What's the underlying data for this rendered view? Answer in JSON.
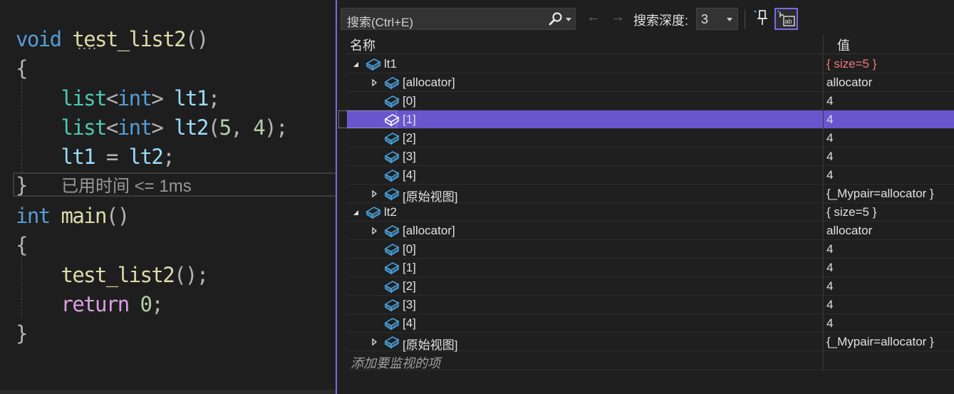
{
  "editor": {
    "perf_tip": "已用时间 <= 1ms"
  },
  "watch": {
    "search_placeholder": "搜索(Ctrl+E)",
    "nav_back": "←",
    "nav_forward": "→",
    "depth_label": "搜索深度:",
    "depth_value": "3",
    "col_name": "名称",
    "col_value": "值",
    "add_item": "添加要监视的项",
    "rows": [
      {
        "name": "lt1",
        "value": "{ size=5 }",
        "level": 0,
        "toggle": "expanded",
        "changed": true,
        "selected": false
      },
      {
        "name": "[allocator]",
        "value": "allocator",
        "level": 1,
        "toggle": "collapsed",
        "changed": false,
        "selected": false
      },
      {
        "name": "[0]",
        "value": "4",
        "level": 1,
        "toggle": "none",
        "changed": false,
        "selected": false
      },
      {
        "name": "[1]",
        "value": "4",
        "level": 1,
        "toggle": "none",
        "changed": false,
        "selected": true
      },
      {
        "name": "[2]",
        "value": "4",
        "level": 1,
        "toggle": "none",
        "changed": false,
        "selected": false
      },
      {
        "name": "[3]",
        "value": "4",
        "level": 1,
        "toggle": "none",
        "changed": false,
        "selected": false
      },
      {
        "name": "[4]",
        "value": "4",
        "level": 1,
        "toggle": "none",
        "changed": false,
        "selected": false
      },
      {
        "name": "[原始视图]",
        "value": "{_Mypair=allocator }",
        "level": 1,
        "toggle": "collapsed",
        "changed": false,
        "selected": false
      },
      {
        "name": "lt2",
        "value": "{ size=5 }",
        "level": 0,
        "toggle": "expanded",
        "changed": false,
        "selected": false
      },
      {
        "name": "[allocator]",
        "value": "allocator",
        "level": 1,
        "toggle": "collapsed",
        "changed": false,
        "selected": false
      },
      {
        "name": "[0]",
        "value": "4",
        "level": 1,
        "toggle": "none",
        "changed": false,
        "selected": false
      },
      {
        "name": "[1]",
        "value": "4",
        "level": 1,
        "toggle": "none",
        "changed": false,
        "selected": false
      },
      {
        "name": "[2]",
        "value": "4",
        "level": 1,
        "toggle": "none",
        "changed": false,
        "selected": false
      },
      {
        "name": "[3]",
        "value": "4",
        "level": 1,
        "toggle": "none",
        "changed": false,
        "selected": false
      },
      {
        "name": "[4]",
        "value": "4",
        "level": 1,
        "toggle": "none",
        "changed": false,
        "selected": false
      },
      {
        "name": "[原始视图]",
        "value": "{_Mypair=allocator }",
        "level": 1,
        "toggle": "collapsed",
        "changed": false,
        "selected": false
      }
    ]
  },
  "colors": {
    "accent": "#7a6bd9",
    "selection": "#6956cf",
    "changed_value": "#f07a7a",
    "object_icon": "#4aa3df"
  },
  "icons": {
    "object": "object-icon",
    "search": "search-icon",
    "pin": "pin-icon",
    "hex": "hex-display-icon"
  }
}
